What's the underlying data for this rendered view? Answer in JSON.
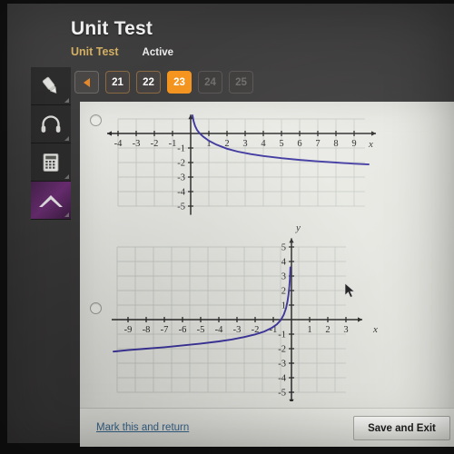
{
  "header": {
    "title": "Unit Test",
    "tab_label": "Unit Test",
    "status_label": "Active"
  },
  "pager": {
    "prev_label": "",
    "items": [
      {
        "label": "21",
        "state": "available"
      },
      {
        "label": "22",
        "state": "available"
      },
      {
        "label": "23",
        "state": "current"
      },
      {
        "label": "24",
        "state": "disabled"
      },
      {
        "label": "25",
        "state": "disabled"
      }
    ]
  },
  "tools": [
    {
      "icon": "highlighter-icon"
    },
    {
      "icon": "headphones-icon"
    },
    {
      "icon": "calculator-icon"
    },
    {
      "icon": "chevron-up-icon"
    }
  ],
  "footer": {
    "mark_link": "Mark this and return",
    "save_button": "Save and Exit"
  },
  "colors": {
    "accent_orange": "#f5941d",
    "tab_gold": "#d7b264",
    "link_blue": "#3a6a92",
    "curve_purple": "#3c35a0",
    "chrome_dark": "#3b3a3a",
    "paper": "#e9e9e5"
  },
  "choices": [
    {
      "id": "choice-a",
      "selected": false
    },
    {
      "id": "choice-b",
      "selected": false
    }
  ],
  "chart_data": [
    {
      "type": "line",
      "id": "graph-a",
      "title": "",
      "xlabel": "x",
      "ylabel": "",
      "xlim": [
        -4.6,
        10.2
      ],
      "ylim": [
        -5.6,
        1.3
      ],
      "xticks": [
        -4,
        -3,
        -2,
        -1,
        1,
        2,
        3,
        4,
        5,
        6,
        7,
        8,
        9
      ],
      "yticks": [
        -1,
        -2,
        -3,
        -4,
        -5
      ],
      "xtick_labels": [
        "-4",
        "-3",
        "-2",
        "-1",
        "1",
        "2",
        "3",
        "4",
        "5",
        "6",
        "7",
        "8",
        "9"
      ],
      "ytick_labels": [
        "-1",
        "-2",
        "-3",
        "-4",
        "-5"
      ],
      "grid": true,
      "curve_label": "decreasing logarithmic curve, vertical asymptote at x = 0",
      "points": [
        {
          "x": 0.1,
          "y": 1.25
        },
        {
          "x": 0.16,
          "y": 0.85
        },
        {
          "x": 0.24,
          "y": 0.52
        },
        {
          "x": 0.35,
          "y": 0.24
        },
        {
          "x": 0.5,
          "y": 0.0
        },
        {
          "x": 0.7,
          "y": -0.23
        },
        {
          "x": 1.0,
          "y": -0.5
        },
        {
          "x": 1.4,
          "y": -0.76
        },
        {
          "x": 2.0,
          "y": -1.05
        },
        {
          "x": 2.6,
          "y": -1.25
        },
        {
          "x": 3.3,
          "y": -1.42
        },
        {
          "x": 4.0,
          "y": -1.55
        },
        {
          "x": 5.0,
          "y": -1.7
        },
        {
          "x": 6.0,
          "y": -1.82
        },
        {
          "x": 7.0,
          "y": -1.92
        },
        {
          "x": 8.0,
          "y": -2.0
        },
        {
          "x": 9.0,
          "y": -2.08
        },
        {
          "x": 9.8,
          "y": -2.13
        }
      ]
    },
    {
      "type": "line",
      "id": "graph-b",
      "title": "",
      "xlabel": "x",
      "ylabel": "y",
      "xlim": [
        -10.2,
        3.9
      ],
      "ylim": [
        -5.8,
        5.6
      ],
      "xticks": [
        -9,
        -8,
        -7,
        -6,
        -5,
        -4,
        -3,
        -2,
        -1,
        1,
        2,
        3
      ],
      "yticks": [
        5,
        4,
        3,
        2,
        1,
        -1,
        -2,
        -3,
        -4,
        -5
      ],
      "xtick_labels": [
        "-9",
        "-8",
        "-7",
        "-6",
        "-5",
        "-4",
        "-3",
        "-2",
        "-1",
        "1",
        "2",
        "3"
      ],
      "ytick_labels": [
        "5",
        "4",
        "3",
        "2",
        "1",
        "-1",
        "-2",
        "-3",
        "-4",
        "-5"
      ],
      "grid": true,
      "curve_label": "increasing curve rising steeply to vertical asymptote at x = 0",
      "points": [
        {
          "x": -9.8,
          "y": -2.2
        },
        {
          "x": -9.0,
          "y": -2.1
        },
        {
          "x": -8.0,
          "y": -2.0
        },
        {
          "x": -7.0,
          "y": -1.9
        },
        {
          "x": -6.0,
          "y": -1.78
        },
        {
          "x": -5.0,
          "y": -1.65
        },
        {
          "x": -4.0,
          "y": -1.5
        },
        {
          "x": -3.3,
          "y": -1.37
        },
        {
          "x": -2.6,
          "y": -1.2
        },
        {
          "x": -2.0,
          "y": -1.02
        },
        {
          "x": -1.5,
          "y": -0.82
        },
        {
          "x": -1.1,
          "y": -0.58
        },
        {
          "x": -0.8,
          "y": -0.32
        },
        {
          "x": -0.58,
          "y": -0.02
        },
        {
          "x": -0.42,
          "y": 0.35
        },
        {
          "x": -0.3,
          "y": 0.78
        },
        {
          "x": -0.22,
          "y": 1.25
        },
        {
          "x": -0.16,
          "y": 1.75
        },
        {
          "x": -0.12,
          "y": 2.25
        },
        {
          "x": -0.09,
          "y": 2.75
        },
        {
          "x": -0.07,
          "y": 3.25
        },
        {
          "x": -0.06,
          "y": 3.6
        }
      ]
    }
  ]
}
